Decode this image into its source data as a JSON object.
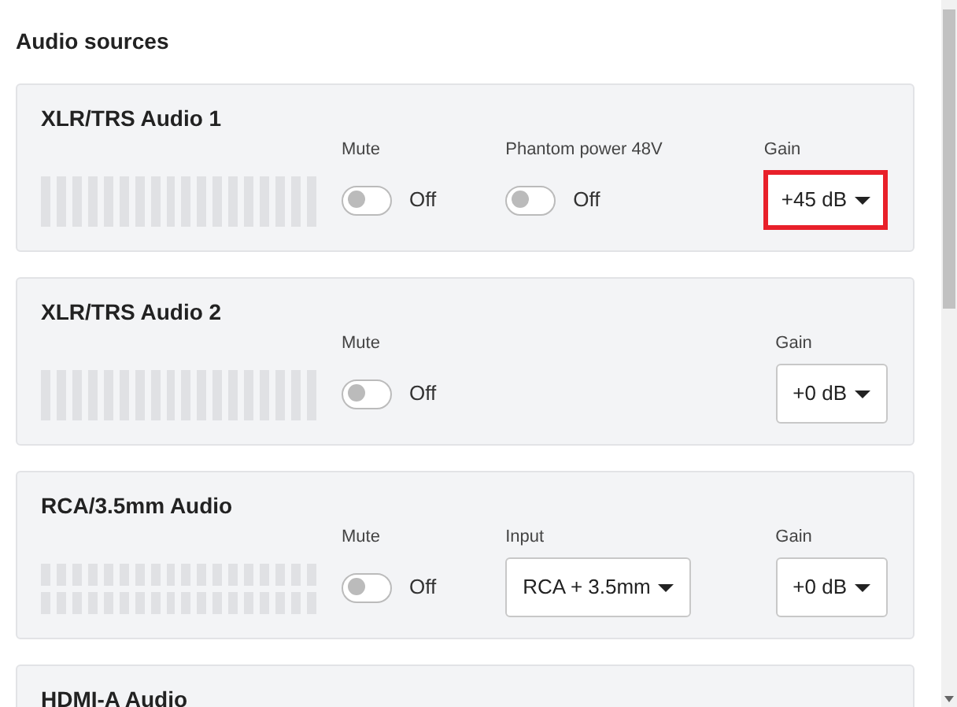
{
  "heading": "Audio sources",
  "sources": [
    {
      "title": "XLR/TRS Audio 1",
      "meter": {
        "kind": "mono"
      },
      "controls": [
        {
          "kind": "toggle",
          "label": "Mute",
          "on": false,
          "state_text": "Off"
        },
        {
          "kind": "toggle",
          "label": "Phantom power 48V",
          "on": false,
          "state_text": "Off"
        },
        {
          "kind": "select",
          "label": "Gain",
          "value": "+45 dB",
          "highlighted": true
        }
      ]
    },
    {
      "title": "XLR/TRS Audio 2",
      "meter": {
        "kind": "mono"
      },
      "controls": [
        {
          "kind": "toggle",
          "label": "Mute",
          "on": false,
          "state_text": "Off"
        },
        {
          "kind": "select",
          "label": "Gain",
          "value": "+0 dB",
          "highlighted": false
        }
      ]
    },
    {
      "title": "RCA/3.5mm Audio",
      "meter": {
        "kind": "stereo"
      },
      "controls": [
        {
          "kind": "toggle",
          "label": "Mute",
          "on": false,
          "state_text": "Off"
        },
        {
          "kind": "select",
          "label": "Input",
          "value": "RCA + 3.5mm",
          "highlighted": false
        },
        {
          "kind": "select",
          "label": "Gain",
          "value": "+0 dB",
          "highlighted": false
        }
      ]
    },
    {
      "title": "HDMI-A Audio"
    }
  ]
}
